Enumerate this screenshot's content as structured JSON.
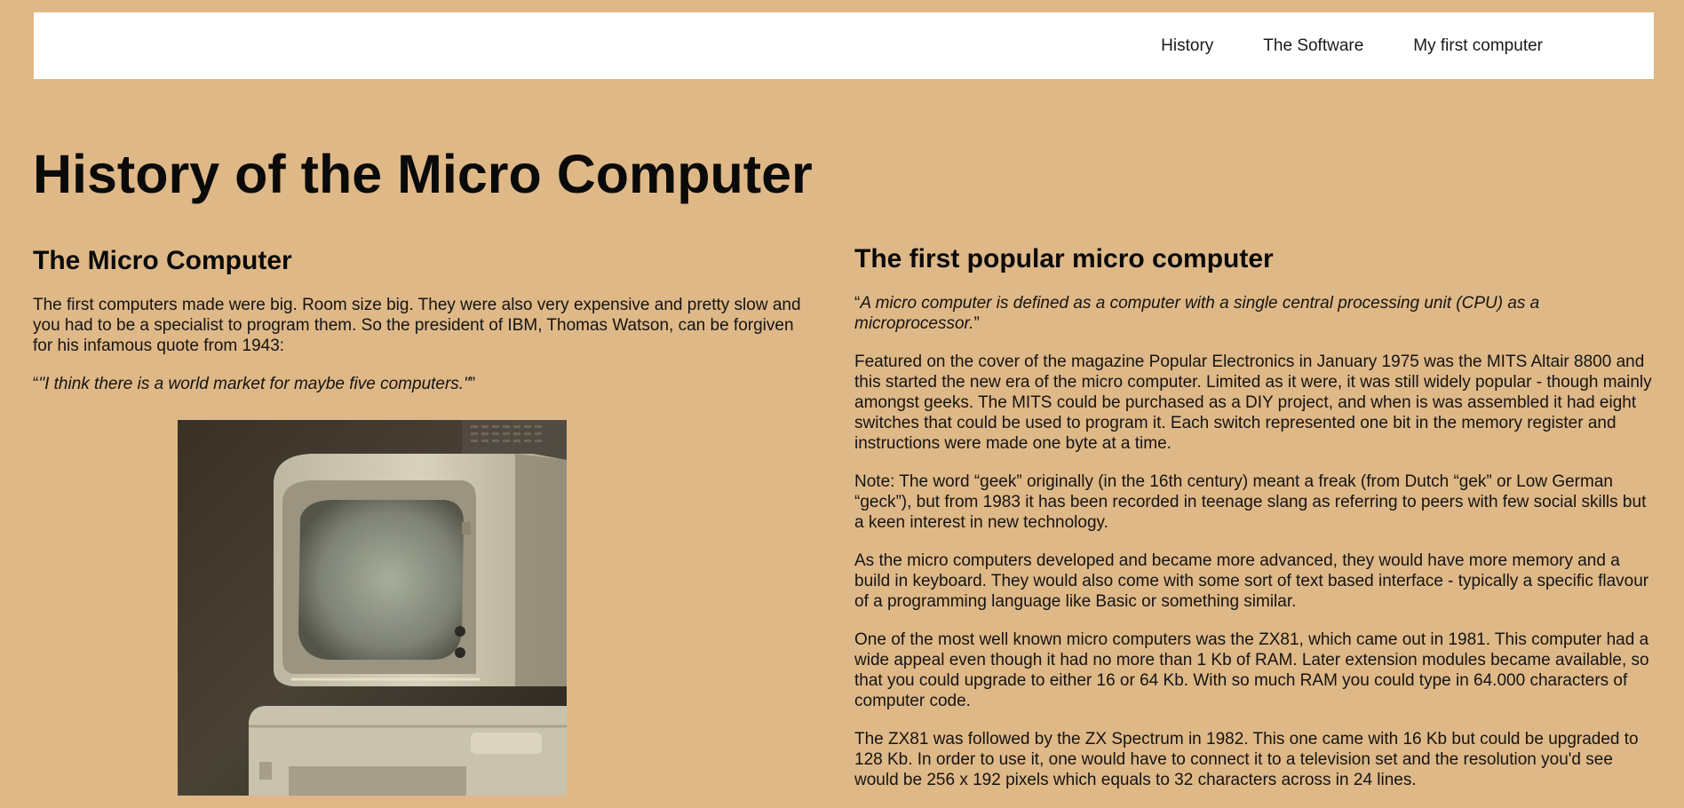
{
  "nav": {
    "items": [
      {
        "label": "History"
      },
      {
        "label": "The Software"
      },
      {
        "label": "My first computer"
      }
    ]
  },
  "page_title": "History of the Micro Computer",
  "left": {
    "heading": "The Micro Computer",
    "paragraph1": "The first computers made were big. Room size big. They were also very expensive and pretty slow and you had to be a specialist to program them. So the president of IBM, Thomas Watson, can be forgiven for his infamous quote from 1943:",
    "quote_open": "“",
    "quote": "\"I think there is a world market for maybe five computers.\"",
    "quote_close": "”"
  },
  "right": {
    "heading": "The first popular micro computer",
    "quote_open": "“",
    "quote": "A micro computer is defined as a computer with a single central processing unit (CPU) as a microprocessor.",
    "quote_close": "”",
    "paragraphs": [
      "Featured on the cover of the magazine Popular Electronics in January 1975 was the MITS Altair 8800 and this started the new era of the micro computer. Limited as it were, it was still widely popular - though mainly amongst geeks. The MITS could be purchased as a DIY project, and when is was assembled it had eight switches that could be used to program it. Each switch represented one bit in the memory register and instructions were made one byte at a time.",
      "Note: The word “geek” originally (in the 16th century) meant a freak (from Dutch “gek” or Low German “geck”), but from 1983 it has been recorded in teenage slang as referring to peers with few social skills but a keen interest in new technology.",
      "As the micro computers developed and became more advanced, they would have more memory and a build in keyboard. They would also come with some sort of text based interface - typically a specific flavour of a programming language like Basic or something similar.",
      "One of the most well known micro computers was the ZX81, which came out in 1981. This computer had a wide appeal even though it had no more than 1 Kb of RAM. Later extension modules became available, so that you could upgrade to either 16 or 64 Kb. With so much RAM you could type in 64.000 characters of computer code.",
      "The ZX81 was followed by the ZX Spectrum in 1982. This one came with 16 Kb but could be upgraded to 128 Kb. In order to use it, one would have to connect it to a television set and the resolution you'd see would be 256 x 192 pixels which equals to 32 characters across in 24 lines."
    ]
  },
  "colors": {
    "background": "#DFB887",
    "navbar": "#FFFFFF",
    "text": "#141414"
  },
  "photo": {
    "icon": "vintage-computer-photo"
  }
}
